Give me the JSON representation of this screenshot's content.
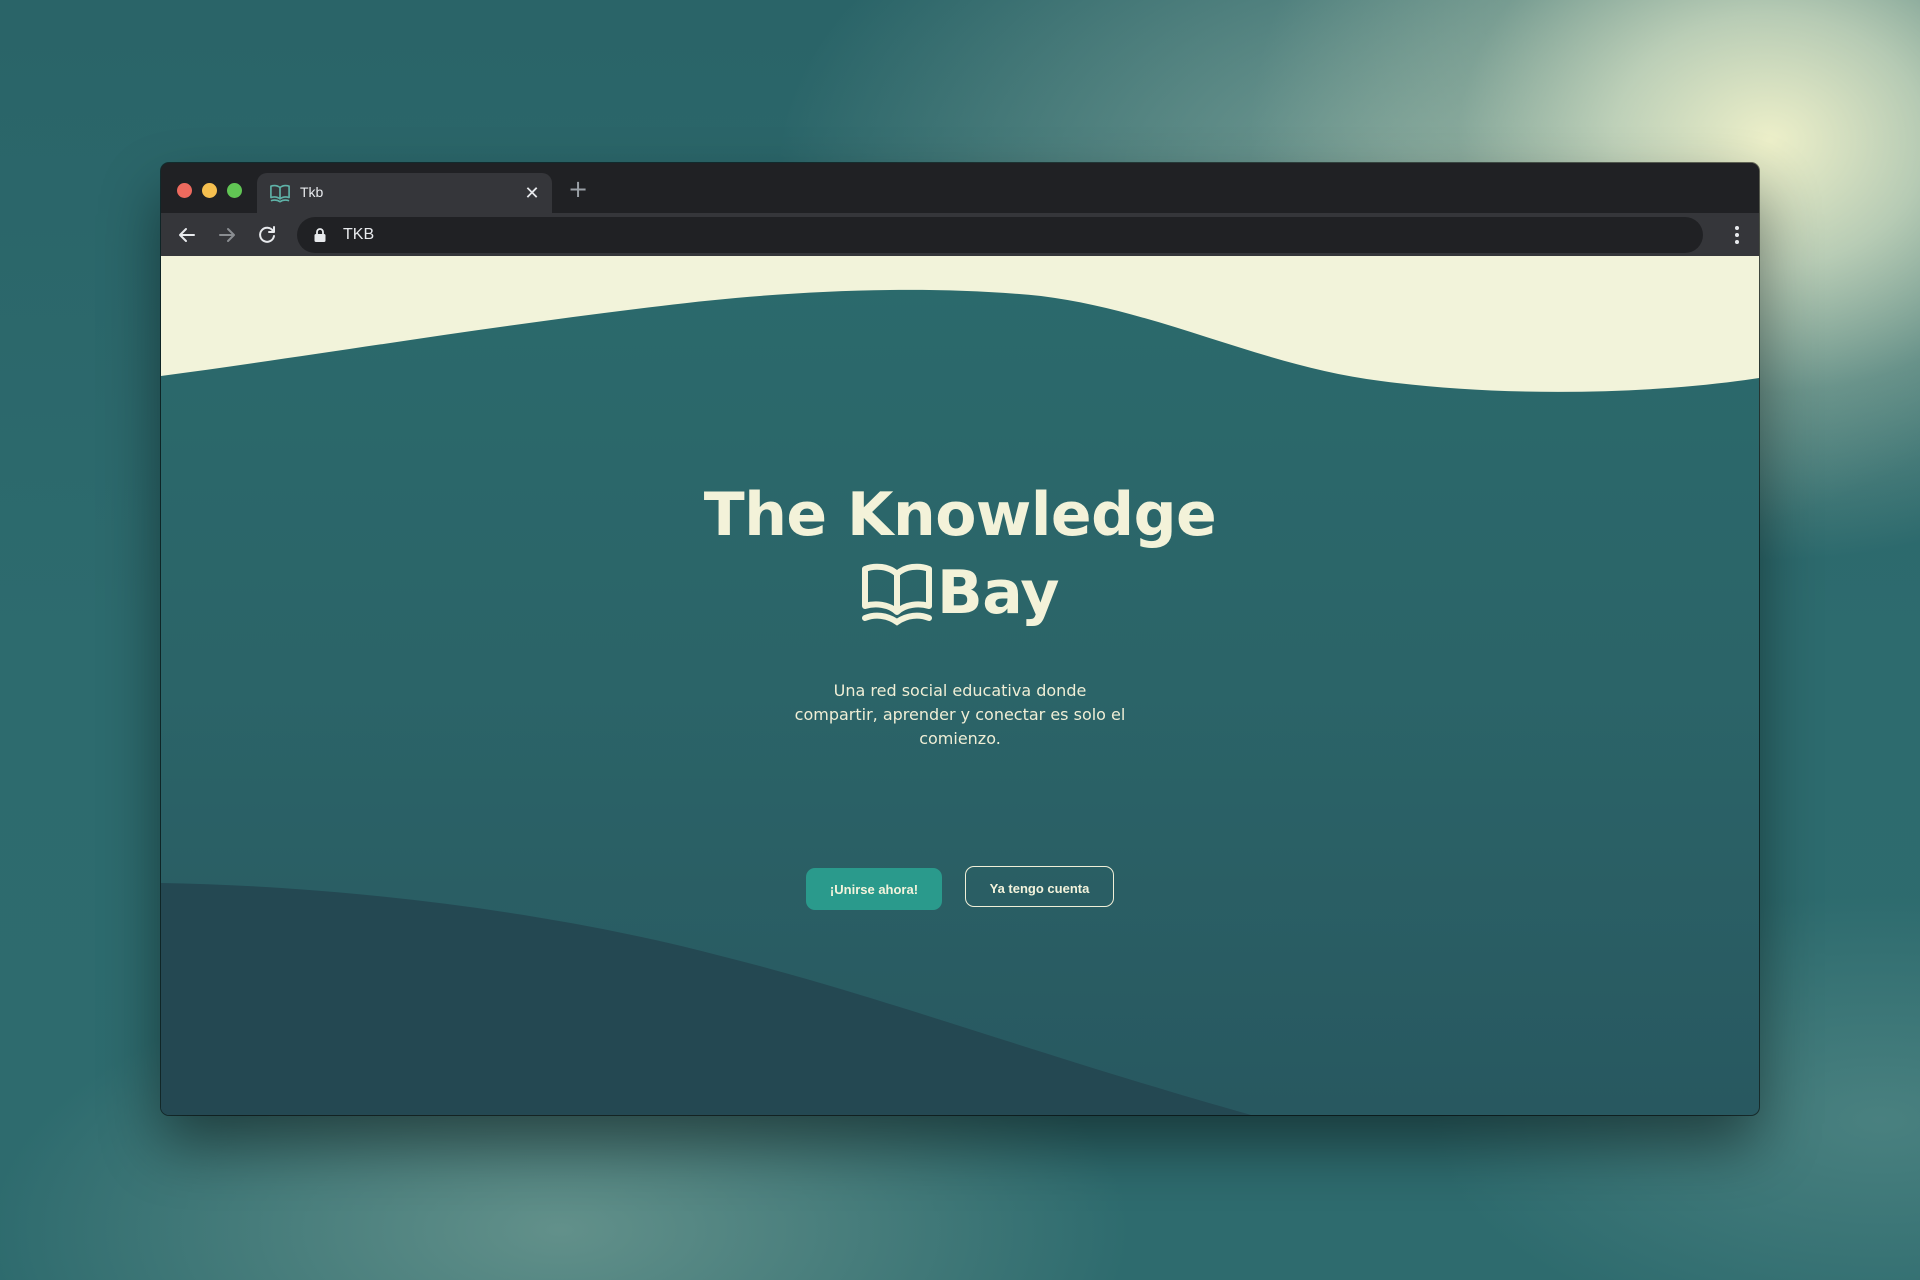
{
  "browser": {
    "tab_title": "Tkb",
    "close_symbol": "✕",
    "new_tab_symbol": "+",
    "address": "TKB",
    "icons": [
      "book-icon",
      "close-icon",
      "plus-icon",
      "back-arrow-icon",
      "forward-arrow-icon",
      "reload-icon",
      "lock-icon",
      "kebab-menu-icon"
    ]
  },
  "hero": {
    "title_line1": "The Knowledge",
    "title_line2": "Bay",
    "subtitle": "Una red social educativa donde compartir, aprender y conectar es solo el comienzo."
  },
  "actions": {
    "primary_label": "¡Unirse ahora!",
    "secondary_label": "Ya tengo cuenta"
  },
  "colors": {
    "cream": "#f3f2d9",
    "teal_background": "#2b6468",
    "accent_button": "#2a9a8c",
    "dark_wave": "#244a52",
    "chrome_dark": "#202124",
    "chrome_toolbar": "#35363a"
  }
}
